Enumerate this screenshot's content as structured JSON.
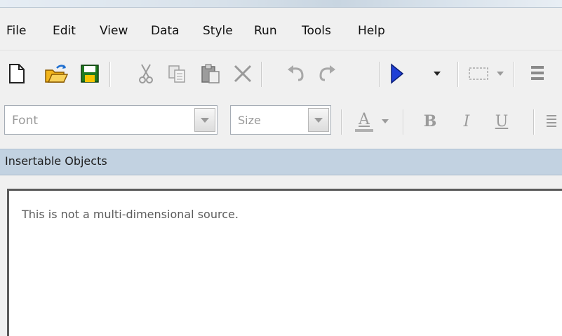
{
  "menu": {
    "items": [
      {
        "label": "File"
      },
      {
        "label": "Edit"
      },
      {
        "label": "View"
      },
      {
        "label": "Data"
      },
      {
        "label": "Style"
      },
      {
        "label": "Run"
      },
      {
        "label": "Tools"
      },
      {
        "label": "Help"
      }
    ]
  },
  "toolbar": {
    "icons": [
      "new-document-icon",
      "open-folder-icon",
      "save-icon",
      "cut-icon",
      "copy-icon",
      "paste-icon",
      "delete-icon",
      "undo-icon",
      "redo-icon",
      "run-icon",
      "run-dropdown-icon",
      "select-region-icon",
      "align-icon"
    ]
  },
  "format": {
    "font_placeholder": "Font",
    "size_placeholder": "Size",
    "font_color_label": "A",
    "bold_label": "B",
    "italic_label": "I",
    "underline_label": "U"
  },
  "panel": {
    "title": "Insertable Objects",
    "message": "This is not a multi-dimensional source."
  },
  "colors": {
    "panel_header": "#c2d2e1",
    "run_arrow": "#1f3fd6",
    "save_icon": "#1f7a1f",
    "open_folder": "#f2b51c"
  }
}
